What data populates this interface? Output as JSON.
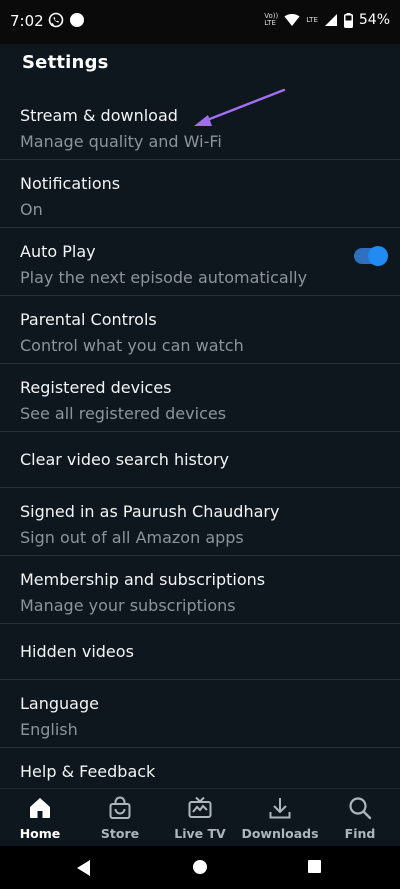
{
  "status_bar": {
    "time": "7:02",
    "volte_label": "Vo))\nLTE",
    "lte_label": "LTE",
    "battery": "54%"
  },
  "header": {
    "title": "Settings"
  },
  "settings": [
    {
      "title": "Stream & download",
      "subtitle": "Manage quality and Wi-Fi"
    },
    {
      "title": "Notifications",
      "subtitle": "On"
    },
    {
      "title": "Auto Play",
      "subtitle": "Play the next episode automatically",
      "toggle": true
    },
    {
      "title": "Parental Controls",
      "subtitle": "Control what you can watch"
    },
    {
      "title": "Registered devices",
      "subtitle": "See all registered devices"
    },
    {
      "title": "Clear video search history"
    },
    {
      "title": "Signed in as Paurush Chaudhary",
      "subtitle": "Sign out of all Amazon apps"
    },
    {
      "title": "Membership and subscriptions",
      "subtitle": "Manage your subscriptions"
    },
    {
      "title": "Hidden videos"
    },
    {
      "title": "Language",
      "subtitle": "English"
    },
    {
      "title": "Help & Feedback"
    }
  ],
  "annotation": {
    "arrow_color": "#a26ef0"
  },
  "bottom_nav": [
    {
      "label": "Home",
      "icon": "home-icon",
      "active": true
    },
    {
      "label": "Store",
      "icon": "shopping-bag-icon"
    },
    {
      "label": "Live TV",
      "icon": "live-tv-icon"
    },
    {
      "label": "Downloads",
      "icon": "download-icon"
    },
    {
      "label": "Find",
      "icon": "search-icon"
    }
  ],
  "colors": {
    "background": "#0f171e",
    "toggle_on": "#1f8bf3",
    "subtitle": "#8b949d"
  }
}
